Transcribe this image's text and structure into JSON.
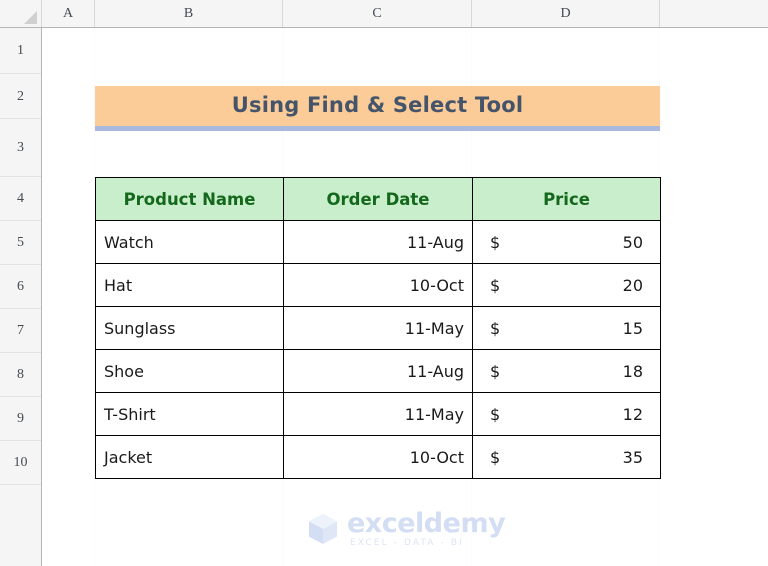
{
  "app": {
    "type": "spreadsheet"
  },
  "grid": {
    "column_headers": [
      "A",
      "B",
      "C",
      "D"
    ],
    "row_headers": [
      "1",
      "2",
      "3",
      "4",
      "5",
      "6",
      "7",
      "8",
      "9",
      "10"
    ],
    "select_all_icon": "select-all-triangle"
  },
  "banner": {
    "title": "Using Find & Select Tool",
    "background_color": "#fbcb98",
    "underline_color": "#a8b9dd",
    "text_color": "#44546a"
  },
  "table": {
    "headers": [
      "Product Name",
      "Order Date",
      "Price"
    ],
    "header_bg_color": "#c9eecb",
    "header_text_color": "#14681c",
    "currency_symbol": "$",
    "rows": [
      {
        "product": "Watch",
        "date": "11-Aug",
        "currency": "$",
        "price": "50"
      },
      {
        "product": "Hat",
        "date": "10-Oct",
        "currency": "$",
        "price": "20"
      },
      {
        "product": "Sunglass",
        "date": "11-May",
        "currency": "$",
        "price": "15"
      },
      {
        "product": "Shoe",
        "date": "11-Aug",
        "currency": "$",
        "price": "18"
      },
      {
        "product": "T-Shirt",
        "date": "11-May",
        "currency": "$",
        "price": "12"
      },
      {
        "product": "Jacket",
        "date": "10-Oct",
        "currency": "$",
        "price": "35"
      }
    ]
  },
  "watermark": {
    "name": "exceldemy",
    "tagline": "EXCEL - DATA - BI",
    "color": "#d3ddf3"
  }
}
